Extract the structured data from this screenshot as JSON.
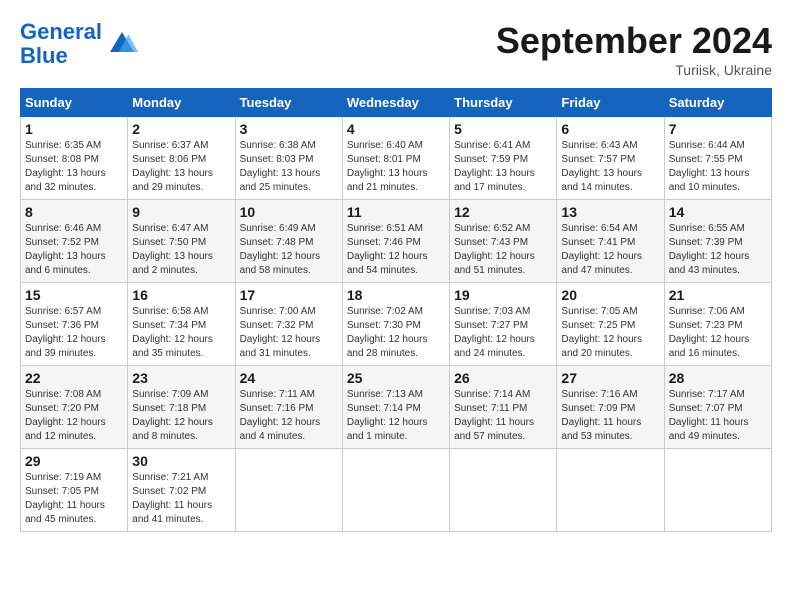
{
  "header": {
    "logo_line1": "General",
    "logo_line2": "Blue",
    "month_title": "September 2024",
    "subtitle": "Turiisk, Ukraine"
  },
  "weekdays": [
    "Sunday",
    "Monday",
    "Tuesday",
    "Wednesday",
    "Thursday",
    "Friday",
    "Saturday"
  ],
  "weeks": [
    [
      {
        "day": "1",
        "sunrise": "Sunrise: 6:35 AM",
        "sunset": "Sunset: 8:08 PM",
        "daylight": "Daylight: 13 hours and 32 minutes."
      },
      {
        "day": "2",
        "sunrise": "Sunrise: 6:37 AM",
        "sunset": "Sunset: 8:06 PM",
        "daylight": "Daylight: 13 hours and 29 minutes."
      },
      {
        "day": "3",
        "sunrise": "Sunrise: 6:38 AM",
        "sunset": "Sunset: 8:03 PM",
        "daylight": "Daylight: 13 hours and 25 minutes."
      },
      {
        "day": "4",
        "sunrise": "Sunrise: 6:40 AM",
        "sunset": "Sunset: 8:01 PM",
        "daylight": "Daylight: 13 hours and 21 minutes."
      },
      {
        "day": "5",
        "sunrise": "Sunrise: 6:41 AM",
        "sunset": "Sunset: 7:59 PM",
        "daylight": "Daylight: 13 hours and 17 minutes."
      },
      {
        "day": "6",
        "sunrise": "Sunrise: 6:43 AM",
        "sunset": "Sunset: 7:57 PM",
        "daylight": "Daylight: 13 hours and 14 minutes."
      },
      {
        "day": "7",
        "sunrise": "Sunrise: 6:44 AM",
        "sunset": "Sunset: 7:55 PM",
        "daylight": "Daylight: 13 hours and 10 minutes."
      }
    ],
    [
      {
        "day": "8",
        "sunrise": "Sunrise: 6:46 AM",
        "sunset": "Sunset: 7:52 PM",
        "daylight": "Daylight: 13 hours and 6 minutes."
      },
      {
        "day": "9",
        "sunrise": "Sunrise: 6:47 AM",
        "sunset": "Sunset: 7:50 PM",
        "daylight": "Daylight: 13 hours and 2 minutes."
      },
      {
        "day": "10",
        "sunrise": "Sunrise: 6:49 AM",
        "sunset": "Sunset: 7:48 PM",
        "daylight": "Daylight: 12 hours and 58 minutes."
      },
      {
        "day": "11",
        "sunrise": "Sunrise: 6:51 AM",
        "sunset": "Sunset: 7:46 PM",
        "daylight": "Daylight: 12 hours and 54 minutes."
      },
      {
        "day": "12",
        "sunrise": "Sunrise: 6:52 AM",
        "sunset": "Sunset: 7:43 PM",
        "daylight": "Daylight: 12 hours and 51 minutes."
      },
      {
        "day": "13",
        "sunrise": "Sunrise: 6:54 AM",
        "sunset": "Sunset: 7:41 PM",
        "daylight": "Daylight: 12 hours and 47 minutes."
      },
      {
        "day": "14",
        "sunrise": "Sunrise: 6:55 AM",
        "sunset": "Sunset: 7:39 PM",
        "daylight": "Daylight: 12 hours and 43 minutes."
      }
    ],
    [
      {
        "day": "15",
        "sunrise": "Sunrise: 6:57 AM",
        "sunset": "Sunset: 7:36 PM",
        "daylight": "Daylight: 12 hours and 39 minutes."
      },
      {
        "day": "16",
        "sunrise": "Sunrise: 6:58 AM",
        "sunset": "Sunset: 7:34 PM",
        "daylight": "Daylight: 12 hours and 35 minutes."
      },
      {
        "day": "17",
        "sunrise": "Sunrise: 7:00 AM",
        "sunset": "Sunset: 7:32 PM",
        "daylight": "Daylight: 12 hours and 31 minutes."
      },
      {
        "day": "18",
        "sunrise": "Sunrise: 7:02 AM",
        "sunset": "Sunset: 7:30 PM",
        "daylight": "Daylight: 12 hours and 28 minutes."
      },
      {
        "day": "19",
        "sunrise": "Sunrise: 7:03 AM",
        "sunset": "Sunset: 7:27 PM",
        "daylight": "Daylight: 12 hours and 24 minutes."
      },
      {
        "day": "20",
        "sunrise": "Sunrise: 7:05 AM",
        "sunset": "Sunset: 7:25 PM",
        "daylight": "Daylight: 12 hours and 20 minutes."
      },
      {
        "day": "21",
        "sunrise": "Sunrise: 7:06 AM",
        "sunset": "Sunset: 7:23 PM",
        "daylight": "Daylight: 12 hours and 16 minutes."
      }
    ],
    [
      {
        "day": "22",
        "sunrise": "Sunrise: 7:08 AM",
        "sunset": "Sunset: 7:20 PM",
        "daylight": "Daylight: 12 hours and 12 minutes."
      },
      {
        "day": "23",
        "sunrise": "Sunrise: 7:09 AM",
        "sunset": "Sunset: 7:18 PM",
        "daylight": "Daylight: 12 hours and 8 minutes."
      },
      {
        "day": "24",
        "sunrise": "Sunrise: 7:11 AM",
        "sunset": "Sunset: 7:16 PM",
        "daylight": "Daylight: 12 hours and 4 minutes."
      },
      {
        "day": "25",
        "sunrise": "Sunrise: 7:13 AM",
        "sunset": "Sunset: 7:14 PM",
        "daylight": "Daylight: 12 hours and 1 minute."
      },
      {
        "day": "26",
        "sunrise": "Sunrise: 7:14 AM",
        "sunset": "Sunset: 7:11 PM",
        "daylight": "Daylight: 11 hours and 57 minutes."
      },
      {
        "day": "27",
        "sunrise": "Sunrise: 7:16 AM",
        "sunset": "Sunset: 7:09 PM",
        "daylight": "Daylight: 11 hours and 53 minutes."
      },
      {
        "day": "28",
        "sunrise": "Sunrise: 7:17 AM",
        "sunset": "Sunset: 7:07 PM",
        "daylight": "Daylight: 11 hours and 49 minutes."
      }
    ],
    [
      {
        "day": "29",
        "sunrise": "Sunrise: 7:19 AM",
        "sunset": "Sunset: 7:05 PM",
        "daylight": "Daylight: 11 hours and 45 minutes."
      },
      {
        "day": "30",
        "sunrise": "Sunrise: 7:21 AM",
        "sunset": "Sunset: 7:02 PM",
        "daylight": "Daylight: 11 hours and 41 minutes."
      },
      null,
      null,
      null,
      null,
      null
    ]
  ]
}
